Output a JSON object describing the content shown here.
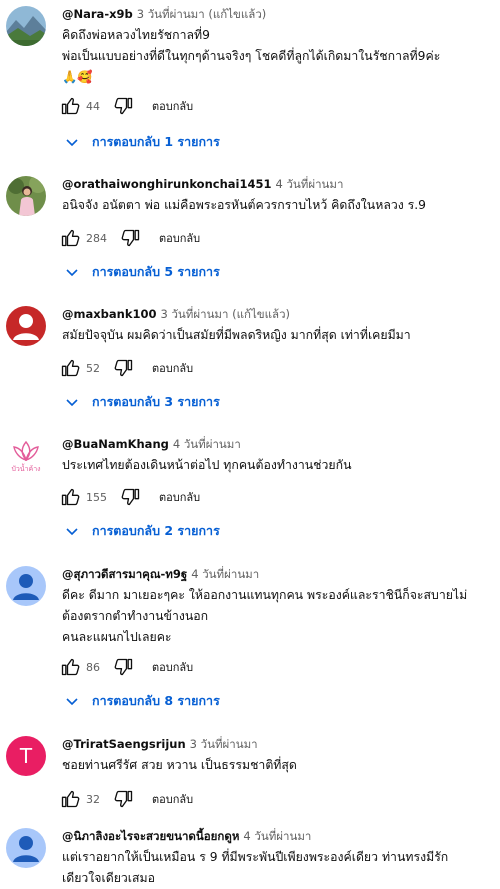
{
  "comments": [
    {
      "author": "@Nara-x9b",
      "time": "3 วันที่ผ่านมา (แก้ไขแล้ว)",
      "lines": [
        "คิดถึงพ่อหลวงไทยรัชกาลที่9",
        "พ่อเป็นแบบอย่างที่ดีในทุกๆด้านจริงๆ  โชคดีที่ลูกได้เกิดมาในรัชกาลที่9ค่ะ",
        "🙏🥰"
      ],
      "likes": "44",
      "reply_label": "ตอบกลับ",
      "replies": "การตอบกลับ 1 รายการ",
      "avatar_icon": "landscape-avatar-icon"
    },
    {
      "author": "@orathaiwonghirunkonchai1451",
      "time": "4 วันที่ผ่านมา",
      "lines": [
        "อนิจจัง อนัตตา พ่อ แม่คือพระอรหันต์ควรกราบไหว้ คิดถึงในหลวง ร.9"
      ],
      "likes": "284",
      "reply_label": "ตอบกลับ",
      "replies": "การตอบกลับ 5 รายการ",
      "avatar_icon": "person-photo-avatar-icon"
    },
    {
      "author": "@maxbank100",
      "time": "3 วันที่ผ่านมา (แก้ไขแล้ว)",
      "lines": [
        "สมัยปัจจุบัน ผมคิดว่าเป็นสมัยที่มีพลดริหญิง  มากที่สุด เท่าที่เคยมีมา"
      ],
      "likes": "52",
      "reply_label": "ตอบกลับ",
      "replies": "การตอบกลับ 3 รายการ",
      "avatar_icon": "default-user-avatar-icon",
      "avatar_color": "#c62828"
    },
    {
      "author": "@BuaNamKhang",
      "time": "4 วันที่ผ่านมา",
      "lines": [
        "ประเทศไทยต้องเดินหน้าต่อไป ทุกคนต้องทำงานช่วยกัน"
      ],
      "likes": "155",
      "reply_label": "ตอบกลับ",
      "replies": "การตอบกลับ 2 รายการ",
      "avatar_icon": "lotus-logo-avatar-icon",
      "avatar_text": "บัวน้ำค้าง"
    },
    {
      "author": "@สุภาวดีสารมาคุณ-ท9ฐ",
      "time": "4 วันที่ผ่านมา",
      "lines": [
        "ดีคะ ดีมาก มาเยอะๆคะ ให้ออกงานแทนทุกคน พระองค์และราชินีก็จะสบายไม่",
        "ต้องตรากตำทำงานข้างนอก",
        "คนละแผนกไปเลยคะ"
      ],
      "likes": "86",
      "reply_label": "ตอบกลับ",
      "replies": "การตอบกลับ 8 รายการ",
      "avatar_icon": "default-user-avatar-icon",
      "avatar_color": "#1e88e5"
    },
    {
      "author": "@TriratSaengsrijun",
      "time": "3 วันที่ผ่านมา",
      "lines": [
        "ชอยท่านศรีรัศ สวย หวาน เป็นธรรมชาติที่สุด"
      ],
      "likes": "32",
      "reply_label": "ตอบกลับ",
      "avatar_icon": "letter-avatar-icon",
      "avatar_letter": "T",
      "avatar_color": "#e91e63"
    },
    {
      "author": "@นิภาลิงอะไรจะสวยขนาดนี้อยกดูห",
      "time": "4 วันที่ผ่านมา",
      "lines": [
        "แต่เราอยากให้เป็นเหมือน ร 9 ที่มีพระพันปีเพียงพระองค์เดียว ท่านทรงมีรัก",
        "เดียวใจเดียวเสมอ"
      ],
      "avatar_icon": "default-user-avatar-icon",
      "avatar_color": "#1e88e5"
    }
  ]
}
